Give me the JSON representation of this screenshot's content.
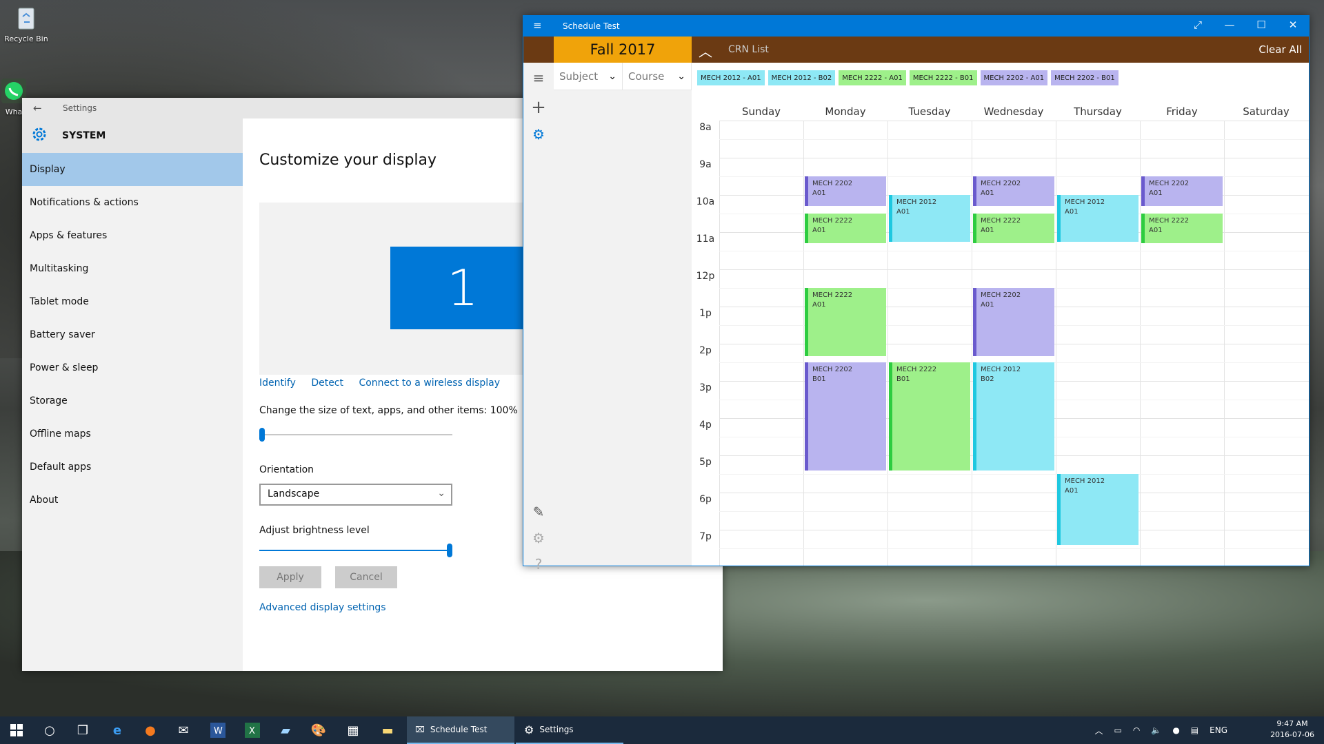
{
  "desktop": {
    "icons": [
      {
        "label": "Recycle Bin",
        "icon": "recycle-bin-icon"
      },
      {
        "label": "Wha",
        "icon": "whatsapp-icon"
      }
    ]
  },
  "settings": {
    "title": "Settings",
    "section": "SYSTEM",
    "nav": [
      {
        "label": "Display",
        "active": true
      },
      {
        "label": "Notifications & actions"
      },
      {
        "label": "Apps & features"
      },
      {
        "label": "Multitasking"
      },
      {
        "label": "Tablet mode"
      },
      {
        "label": "Battery saver"
      },
      {
        "label": "Power & sleep"
      },
      {
        "label": "Storage"
      },
      {
        "label": "Offline maps"
      },
      {
        "label": "Default apps"
      },
      {
        "label": "About"
      }
    ],
    "heading": "Customize your display",
    "monitor_number": "1",
    "links": [
      "Identify",
      "Detect",
      "Connect to a wireless display"
    ],
    "size_label": "Change the size of text, apps, and other items: 100%",
    "size_value_fraction": 0.0,
    "orientation_label": "Orientation",
    "orientation_value": "Landscape",
    "brightness_label": "Adjust brightness level",
    "brightness_fraction": 1.0,
    "apply": "Apply",
    "cancel": "Cancel",
    "advanced_link": "Advanced display settings"
  },
  "schedule": {
    "title": "Schedule Test",
    "season": "Fall 2017",
    "subject_placeholder": "Subject",
    "course_placeholder": "Course",
    "crn_label": "CRN List",
    "clear_all": "Clear All",
    "chips": [
      {
        "label": "MECH 2012 - A01",
        "color": "#8ee8f5"
      },
      {
        "label": "MECH 2012 - B02",
        "color": "#8ee8f5"
      },
      {
        "label": "MECH 2222 - A01",
        "color": "#9ef08a"
      },
      {
        "label": "MECH 2222 - B01",
        "color": "#9ef08a"
      },
      {
        "label": "MECH 2202 - A01",
        "color": "#b9b4ef"
      },
      {
        "label": "MECH 2202 - B01",
        "color": "#b9b4ef"
      }
    ],
    "days": [
      "Sunday",
      "Monday",
      "Tuesday",
      "Wednesday",
      "Thursday",
      "Friday",
      "Saturday"
    ],
    "hours": [
      "8a",
      "9a",
      "10a",
      "11a",
      "12p",
      "1p",
      "2p",
      "3p",
      "4p",
      "5p",
      "6p",
      "7p"
    ],
    "events": [
      {
        "day": 1,
        "start": 9.5,
        "end": 10.3,
        "course": "MECH 2202",
        "section": "A01",
        "kind": "2202"
      },
      {
        "day": 3,
        "start": 9.5,
        "end": 10.3,
        "course": "MECH 2202",
        "section": "A01",
        "kind": "2202"
      },
      {
        "day": 5,
        "start": 9.5,
        "end": 10.3,
        "course": "MECH 2202",
        "section": "A01",
        "kind": "2202"
      },
      {
        "day": 2,
        "start": 10.0,
        "end": 11.25,
        "course": "MECH 2012",
        "section": "A01",
        "kind": "2012"
      },
      {
        "day": 4,
        "start": 10.0,
        "end": 11.25,
        "course": "MECH 2012",
        "section": "A01",
        "kind": "2012"
      },
      {
        "day": 1,
        "start": 10.5,
        "end": 11.3,
        "course": "MECH 2222",
        "section": "A01",
        "kind": "2222"
      },
      {
        "day": 3,
        "start": 10.5,
        "end": 11.3,
        "course": "MECH 2222",
        "section": "A01",
        "kind": "2222"
      },
      {
        "day": 5,
        "start": 10.5,
        "end": 11.3,
        "course": "MECH 2222",
        "section": "A01",
        "kind": "2222"
      },
      {
        "day": 1,
        "start": 12.5,
        "end": 14.33,
        "course": "MECH 2222",
        "section": "A01",
        "kind": "2222"
      },
      {
        "day": 3,
        "start": 12.5,
        "end": 14.33,
        "course": "MECH 2202",
        "section": "A01",
        "kind": "2202"
      },
      {
        "day": 1,
        "start": 14.5,
        "end": 17.4,
        "course": "MECH 2202",
        "section": "B01",
        "kind": "2202"
      },
      {
        "day": 2,
        "start": 14.5,
        "end": 17.4,
        "course": "MECH 2222",
        "section": "B01",
        "kind": "2222"
      },
      {
        "day": 3,
        "start": 14.5,
        "end": 17.4,
        "course": "MECH 2012",
        "section": "B02",
        "kind": "2012"
      },
      {
        "day": 4,
        "start": 17.5,
        "end": 19.4,
        "course": "MECH 2012",
        "section": "A01",
        "kind": "2012"
      }
    ],
    "colors": {
      "2202": {
        "fill": "#b9b4ef",
        "border": "#6a5acd"
      },
      "2222": {
        "fill": "#9ef08a",
        "border": "#2ecc40"
      },
      "2012": {
        "fill": "#8ee8f5",
        "border": "#1ec8e0"
      }
    }
  },
  "taskbar": {
    "apps": [
      {
        "label": "Schedule Test",
        "active": true
      },
      {
        "label": "Settings",
        "active": false
      }
    ],
    "language": "ENG",
    "time": "9:47 AM",
    "date": "2016-07-06"
  }
}
